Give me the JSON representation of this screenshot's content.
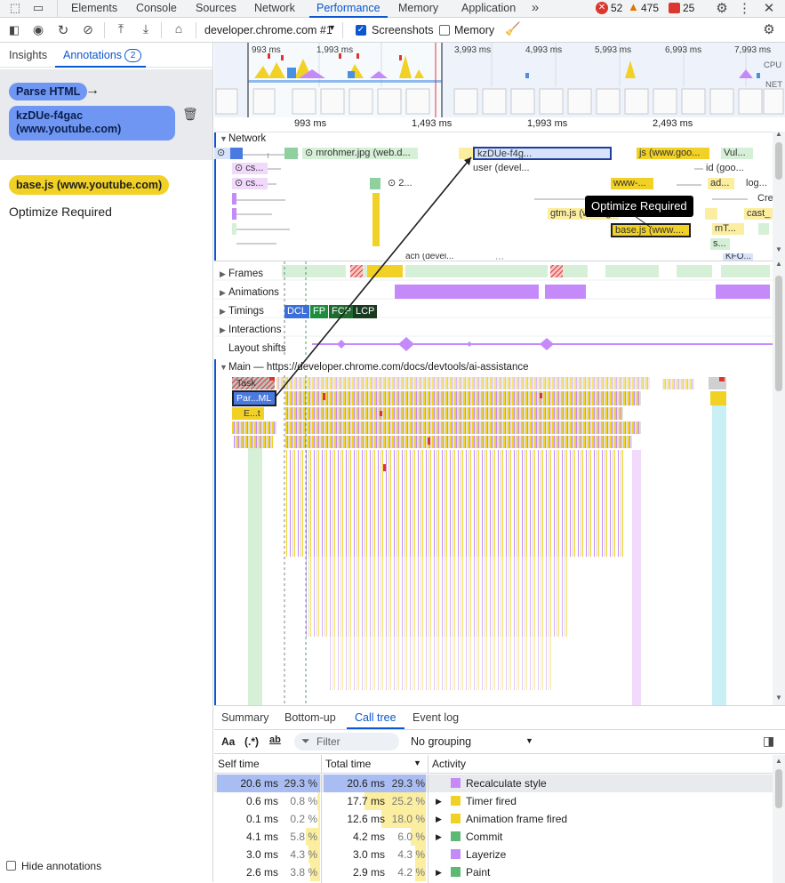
{
  "tabs": {
    "items": [
      {
        "label": "Elements"
      },
      {
        "label": "Console"
      },
      {
        "label": "Sources"
      },
      {
        "label": "Network"
      },
      {
        "label": "Performance"
      },
      {
        "label": "Memory"
      },
      {
        "label": "Application"
      }
    ],
    "errors": "52",
    "warnings": "475",
    "issues": "25"
  },
  "toolbar": {
    "url": "developer.chrome.com #1",
    "screenshots_label": "Screenshots",
    "screenshots_checked": true,
    "memory_label": "Memory",
    "memory_checked": false
  },
  "sidebar": {
    "tab_insights": "Insights",
    "tab_annotations": "Annotations",
    "annotations_count": "2",
    "annotation1_from": "Parse HTML",
    "annotation1_to": "kzDUe-f4gac (www.youtube.com)",
    "annotation2_entry": "base.js (www.youtube.com)",
    "annotation2_label": "Optimize Required",
    "hide_annotations": "Hide annotations"
  },
  "overview": {
    "ticks": [
      "993 ms",
      "1,993 ms",
      "3,993 ms",
      "4,993 ms",
      "5,993 ms",
      "6,993 ms",
      "7,993 ms"
    ],
    "cpu_label": "CPU",
    "net_label": "NET"
  },
  "timeline": {
    "ticks": [
      "993 ms",
      "1,493 ms",
      "1,993 ms",
      "2,493 ms"
    ],
    "network_label": "Network",
    "network_bars": [
      "mrohmer.jpg (web.d...",
      "kzDUe-f4g...",
      "js (www.goo...",
      "Vul...",
      "user (devel...",
      "id (goo...",
      "cs...",
      "cs...",
      "2...",
      "www-...",
      "ad...",
      "log...",
      "Cre",
      "gtm.js (www.goo...",
      "cast_",
      "base.js (www....",
      "mT...",
      "s...",
      "ach (devel...",
      "KFO..."
    ],
    "tooltip": "Optimize Required",
    "tracks": {
      "frames": "Frames",
      "animations": "Animations",
      "timings": "Timings",
      "interactions": "Interactions",
      "layout_shifts": "Layout shifts"
    },
    "timing_markers": [
      "DCL",
      "FP",
      "FCP",
      "LCP"
    ],
    "main_label": "Main — https://developer.chrome.com/docs/devtools/ai-assistance",
    "task_label": "Task",
    "parse_label": "Par...ML",
    "eval_label": "E...t"
  },
  "bottom": {
    "tabs": [
      "Summary",
      "Bottom-up",
      "Call tree",
      "Event log"
    ],
    "filter_placeholder": "Filter",
    "grouping": "No grouping",
    "col_self": "Self time",
    "col_total": "Total time",
    "col_activity": "Activity",
    "rows": [
      {
        "self": "20.6 ms",
        "self_pct": "29.3 %",
        "total": "20.6 ms",
        "total_pct": "29.3 %",
        "activity": "Recalculate style",
        "color": "#c58af9",
        "expand": false
      },
      {
        "self": "0.6 ms",
        "self_pct": "0.8 %",
        "total": "17.7 ms",
        "total_pct": "25.2 %",
        "activity": "Timer fired",
        "color": "#f2d126",
        "expand": true
      },
      {
        "self": "0.1 ms",
        "self_pct": "0.2 %",
        "total": "12.6 ms",
        "total_pct": "18.0 %",
        "activity": "Animation frame fired",
        "color": "#f2d126",
        "expand": true
      },
      {
        "self": "4.1 ms",
        "self_pct": "5.8 %",
        "total": "4.2 ms",
        "total_pct": "6.0 %",
        "activity": "Commit",
        "color": "#5bb974",
        "expand": true
      },
      {
        "self": "3.0 ms",
        "self_pct": "4.3 %",
        "total": "3.0 ms",
        "total_pct": "4.3 %",
        "activity": "Layerize",
        "color": "#c58af9",
        "expand": false
      },
      {
        "self": "2.6 ms",
        "self_pct": "3.8 %",
        "total": "2.9 ms",
        "total_pct": "4.2 %",
        "activity": "Paint",
        "color": "#5bb974",
        "expand": true
      }
    ]
  },
  "colors": {
    "accent": "#0b57d0",
    "scripting": "#f2d126",
    "rendering": "#c58af9",
    "painting": "#5bb974",
    "annotation_blue": "#6f96f2"
  }
}
